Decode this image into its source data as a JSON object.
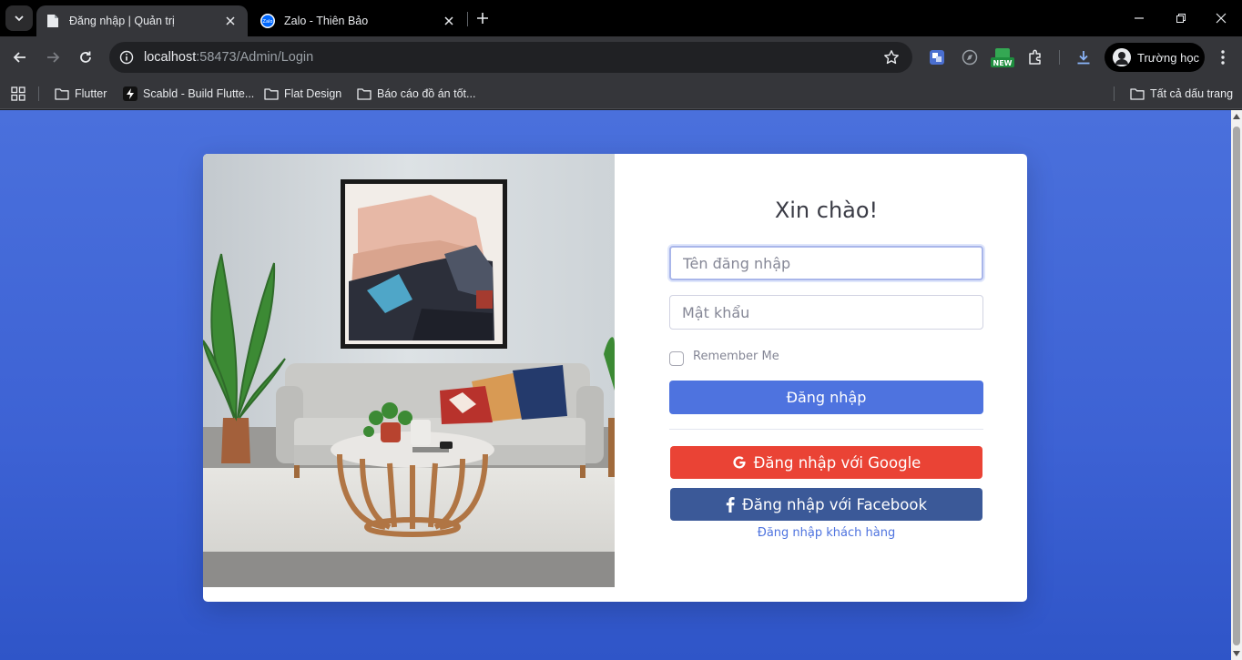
{
  "browser": {
    "tabs": [
      {
        "title": "Đăng nhập | Quản trị",
        "active": true
      },
      {
        "title": "Zalo - Thiên Bảo",
        "active": false
      }
    ],
    "address": {
      "host": "localhost",
      "path": ":58473/Admin/Login"
    },
    "extensions": {
      "new_badge": "NEW"
    },
    "profile_name": "Trường học",
    "bookmarks": [
      {
        "label": "Flutter",
        "icon": "folder-icon"
      },
      {
        "label": "Scabld - Build Flutte...",
        "icon": "scabld-favicon"
      },
      {
        "label": "Flat Design",
        "icon": "folder-icon"
      },
      {
        "label": "Báo cáo đồ án tốt...",
        "icon": "folder-icon"
      }
    ],
    "all_bookmarks_label": "Tất cả dấu trang"
  },
  "login": {
    "greeting": "Xin chào!",
    "username_placeholder": "Tên đăng nhập",
    "password_placeholder": "Mật khẩu",
    "remember_label": "Remember Me",
    "login_button": "Đăng nhập",
    "google_button": "Đăng nhập với Google",
    "facebook_button": "Đăng nhập với Facebook",
    "guest_link": "Đăng nhập khách hàng"
  },
  "colors": {
    "page_background": "#4a70dc",
    "primary": "#4e73df",
    "google": "#ea4335",
    "facebook": "#3b5998"
  }
}
